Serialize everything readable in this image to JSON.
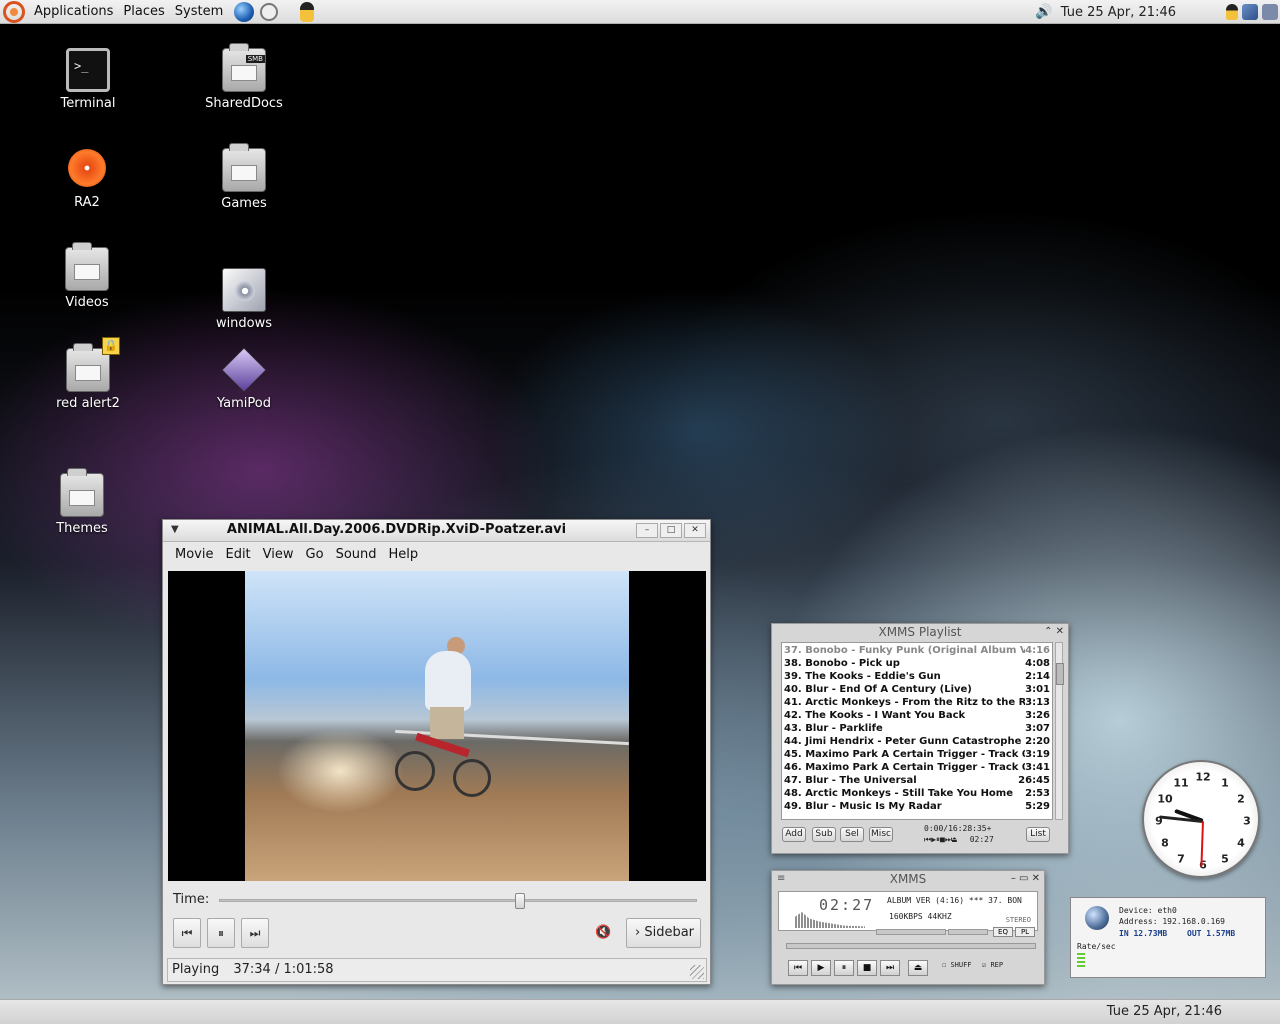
{
  "top_panel": {
    "menus": [
      "Applications",
      "Places",
      "System"
    ],
    "clock": "Tue 25 Apr, 21:46"
  },
  "desktop_icons": [
    {
      "label": "Terminal",
      "icon": "terminal-icon"
    },
    {
      "label": "SharedDocs",
      "icon": "network-share-icon",
      "badge": "SMB"
    },
    {
      "label": "RA2",
      "icon": "cd-icon"
    },
    {
      "label": "Games",
      "icon": "folder-icon"
    },
    {
      "label": "Videos",
      "icon": "folder-icon"
    },
    {
      "label": "windows",
      "icon": "drive-icon"
    },
    {
      "label": "red alert2",
      "icon": "folder-icon"
    },
    {
      "label": "YamiPod",
      "icon": "app-icon"
    },
    {
      "label": "Themes",
      "icon": "folder-icon"
    }
  ],
  "totem": {
    "title": "ANIMAL.All.Day.2006.DVDRip.XviD-Poatzer.avi",
    "menu": [
      "Movie",
      "Edit",
      "View",
      "Go",
      "Sound",
      "Help"
    ],
    "time_label": "Time:",
    "seek_fraction": 0.62,
    "sidebar_label": "Sidebar",
    "status": "Playing",
    "position": "37:34 / 1:01:58"
  },
  "xmms_playlist": {
    "title": "XMMS Playlist",
    "items": [
      {
        "title": "37. Bonobo - Funky Punk (Original Album Ver",
        "time": "4:16"
      },
      {
        "title": "38. Bonobo - Pick up",
        "time": "4:08"
      },
      {
        "title": "39. The Kooks - Eddie's Gun",
        "time": "2:14"
      },
      {
        "title": "40. Blur - End Of A Century (Live)",
        "time": "3:01"
      },
      {
        "title": "41. Arctic Monkeys - From the Ritz to the Rubble",
        "time": "3:13"
      },
      {
        "title": "42. The Kooks - I Want You Back",
        "time": "3:26"
      },
      {
        "title": "43. Blur - Parklife",
        "time": "3:07"
      },
      {
        "title": "44. Jimi Hendrix - Peter Gunn Catastrophe",
        "time": "2:20"
      },
      {
        "title": "45. Maximo Park A Certain Trigger - Track 08",
        "time": "3:19"
      },
      {
        "title": "46. Maximo Park A Certain Trigger - Track 05",
        "time": "3:41"
      },
      {
        "title": "47. Blur - The Universal",
        "time": "26:45"
      },
      {
        "title": "48. Arctic Monkeys - Still Take You Home",
        "time": "2:53"
      },
      {
        "title": "49. Blur - Music Is My Radar",
        "time": "5:29"
      }
    ],
    "buttons": [
      "Add",
      "Sub",
      "Sel",
      "Misc",
      "List"
    ],
    "lcd_total": "0:00/16:28:35+",
    "lcd_time": "02:27"
  },
  "xmms_main": {
    "title": "XMMS",
    "time": "02:27",
    "song": "ALBUM VER (4:16)  ***  37. BON",
    "kbps": "160",
    "kbps_unit": "KBPS",
    "khz": "44",
    "khz_unit": "KHZ",
    "stereo": "STEREO",
    "eq_label": "EQ",
    "pl_label": "PL",
    "shuffle_label": "SHUFF",
    "repeat_label": "REP"
  },
  "netmon": {
    "device": "Device: eth0",
    "address": "Address: 192.168.0.169",
    "in": "IN 12.73MB",
    "out": "OUT 1.57MB",
    "rate": "Rate/sec"
  },
  "bottom_panel": {
    "clock": "Tue 25 Apr, 21:46"
  },
  "colors": {
    "panel": "#dcdcdc",
    "accent_orange": "#e64a12"
  }
}
